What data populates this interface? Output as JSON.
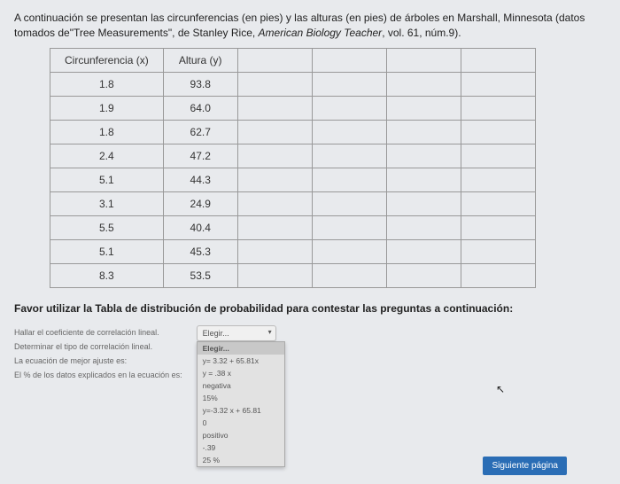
{
  "prompt": {
    "intro_part1": "A continuación se presentan las circunferencias (en pies) y las alturas (en pies) de árboles en Marshall, Minnesota (datos tomados de\"Tree Measurements\", de Stanley Rice, ",
    "journal": "American Biology Teacher",
    "intro_part2": ", vol. 61, núm.9)."
  },
  "table": {
    "header_x": "Circunferencia (x)",
    "header_y": "Altura (y)",
    "rows": [
      {
        "x": "1.8",
        "y": "93.8"
      },
      {
        "x": "1.9",
        "y": "64.0"
      },
      {
        "x": "1.8",
        "y": "62.7"
      },
      {
        "x": "2.4",
        "y": "47.2"
      },
      {
        "x": "5.1",
        "y": "44.3"
      },
      {
        "x": "3.1",
        "y": "24.9"
      },
      {
        "x": "5.5",
        "y": "40.4"
      },
      {
        "x": "5.1",
        "y": "45.3"
      },
      {
        "x": "8.3",
        "y": "53.5"
      }
    ],
    "extra_cols": 4
  },
  "instruction": "Favor utilizar la Tabla de distribución de probabilidad para contestar las preguntas a continuación:",
  "questions": {
    "q1": "Hallar el coeficiente de correlación lineal.",
    "q2": "Determinar el tipo de correlación lineal.",
    "q3": "La ecuación de mejor ajuste es:",
    "q4": "El % de los datos explicados en la ecuación es:"
  },
  "select": {
    "placeholder": "Elegir...",
    "header": "Elegir...",
    "options": [
      "y= 3.32 + 65.81x",
      "y = .38 x",
      "negativa",
      "15%",
      "y=-3.32 x + 65.81",
      "0",
      "positivo",
      "-.39",
      "25 %"
    ]
  },
  "nav": {
    "next": "Siguiente página"
  }
}
